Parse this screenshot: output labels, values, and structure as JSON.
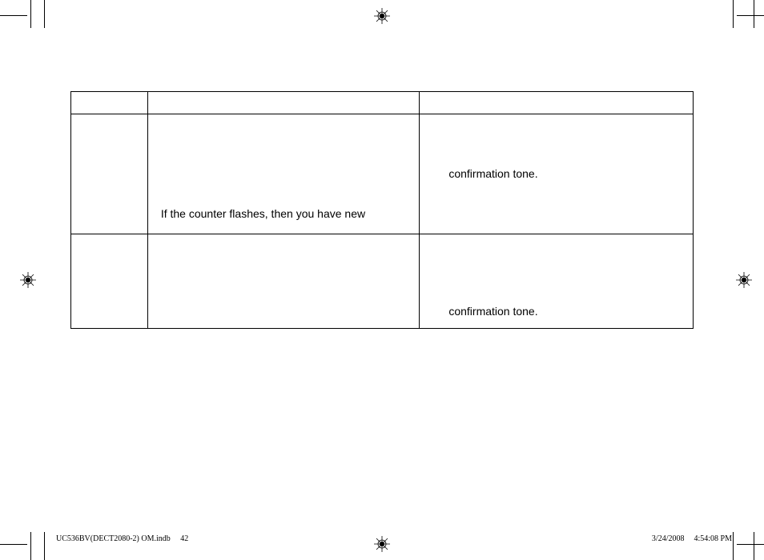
{
  "table": {
    "row1": {
      "c1": "",
      "c2": "",
      "c3": ""
    },
    "row2": {
      "c1": "",
      "c2": "If the counter flashes, then you have new",
      "c3": "confirmation tone."
    },
    "row3": {
      "c1": "",
      "c2": "",
      "c3": "confirmation tone."
    }
  },
  "footer": {
    "filename": "UC536BV(DECT2080-2) OM.indb",
    "page": "42",
    "date": "3/24/2008",
    "time": "4:54:08 PM"
  }
}
